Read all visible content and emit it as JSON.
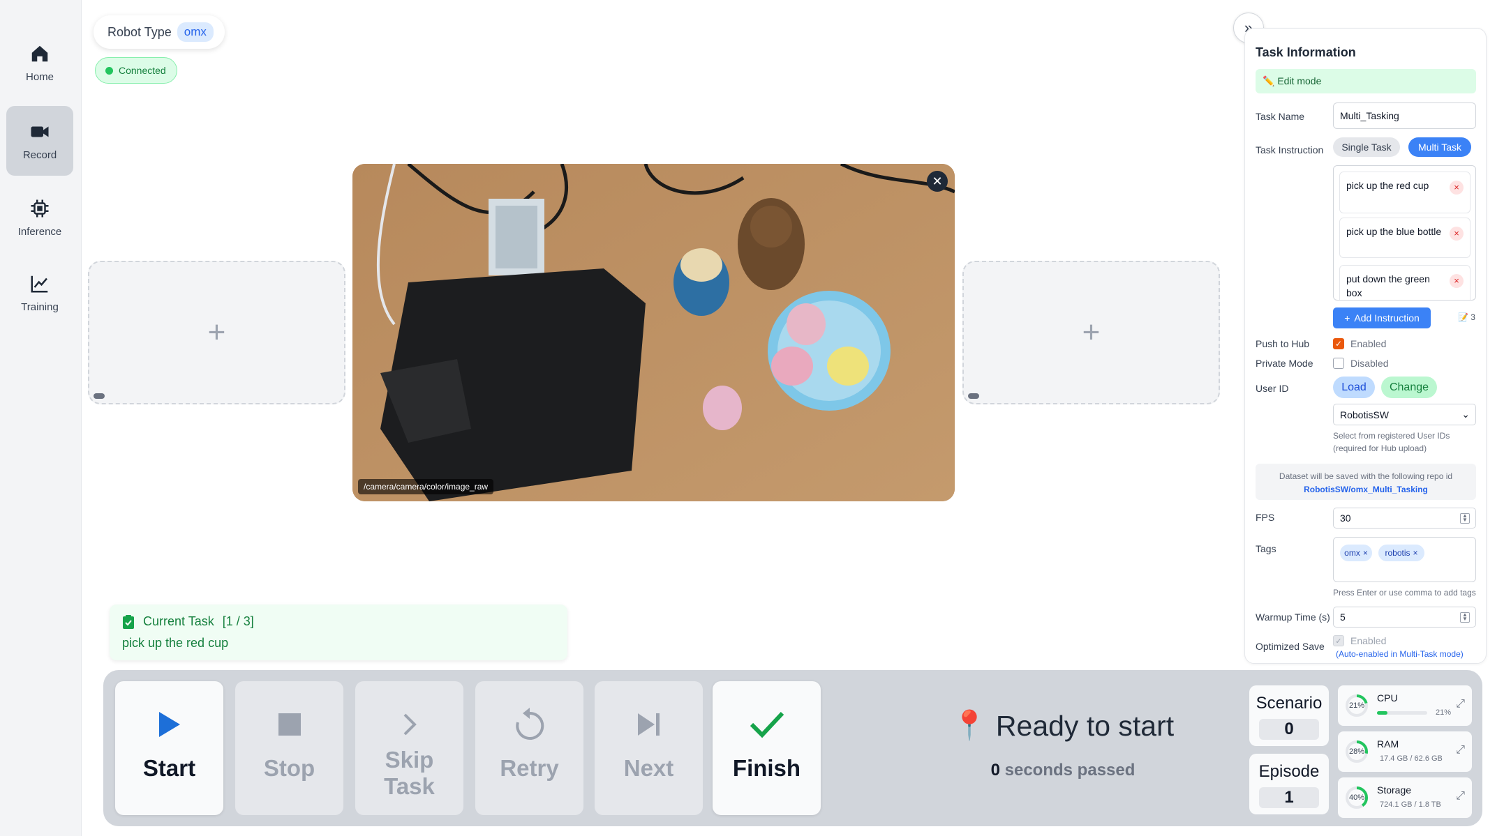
{
  "sidebar": {
    "items": [
      {
        "label": "Home",
        "icon": "home-icon",
        "active": false
      },
      {
        "label": "Record",
        "icon": "video-camera-icon",
        "active": true
      },
      {
        "label": "Inference",
        "icon": "chip-icon",
        "active": false
      },
      {
        "label": "Training",
        "icon": "chart-line-icon",
        "active": false
      }
    ]
  },
  "header": {
    "robot_type_label": "Robot Type",
    "robot_type_value": "omx",
    "connection_status": "Connected"
  },
  "camera": {
    "topic": "/camera/camera/color/image_raw",
    "close_symbol": "✕",
    "add_symbol": "+"
  },
  "current_task": {
    "label": "Current Task",
    "progress": "[1 / 3]",
    "text": "pick up the red cup"
  },
  "controls": {
    "start": "Start",
    "stop": "Stop",
    "skip_line1": "Skip",
    "skip_line2": "Task",
    "retry": "Retry",
    "next": "Next",
    "finish": "Finish",
    "status_text": "Ready to start",
    "status_icon": "📍",
    "seconds_value": "0",
    "seconds_text": "seconds passed",
    "scenario_label": "Scenario",
    "scenario_value": "0",
    "episode_label": "Episode",
    "episode_value": "1"
  },
  "resources": {
    "cpu": {
      "name": "CPU",
      "percent": "21%",
      "bar_pct": "21%",
      "fraction": 0.21
    },
    "ram": {
      "name": "RAM",
      "percent": "28%",
      "detail": "17.4 GB / 62.6 GB",
      "fraction": 0.28
    },
    "storage": {
      "name": "Storage",
      "percent": "40%",
      "detail": "724.1 GB / 1.8 TB",
      "fraction": 0.4
    }
  },
  "task_panel": {
    "collapse_symbol": "»",
    "title": "Task Information",
    "edit_mode": "✏️ Edit mode",
    "task_name_label": "Task Name",
    "task_name_value": "Multi_Tasking",
    "task_instruction_label": "Task Instruction",
    "single_task": "Single Task",
    "multi_task": "Multi Task",
    "instructions": [
      {
        "text": "pick up the red cup"
      },
      {
        "text": "pick up the blue bottle"
      },
      {
        "text": "put down the green box"
      }
    ],
    "remove_symbol": "×",
    "add_instruction": "Add Instruction",
    "instruction_count": "📝 3",
    "push_to_hub_label": "Push to Hub",
    "push_to_hub_value": "Enabled",
    "private_mode_label": "Private Mode",
    "private_mode_value": "Disabled",
    "user_id_label": "User ID",
    "load": "Load",
    "change": "Change",
    "user_id_value": "RobotisSW",
    "user_id_help_1": "Select from registered User IDs",
    "user_id_help_2": "(required for Hub upload)",
    "repo_note": "Dataset will be saved with the following repo id",
    "repo_id": "RobotisSW/omx_Multi_Tasking",
    "fps_label": "FPS",
    "fps_value": "30",
    "tags_label": "Tags",
    "tags": [
      {
        "text": "omx"
      },
      {
        "text": "robotis"
      }
    ],
    "tags_help": "Press Enter or use comma to add tags",
    "warmup_label": "Warmup Time (s)",
    "warmup_value": "5",
    "optimized_label": "Optimized Save",
    "optimized_value": "Enabled",
    "optimized_note": "(Auto-enabled in Multi-Task mode)"
  },
  "colors": {
    "accent": "#3b82f6",
    "success": "#22c55e",
    "start_icon": "#1d6fd8",
    "finish_icon": "#16a34a"
  }
}
